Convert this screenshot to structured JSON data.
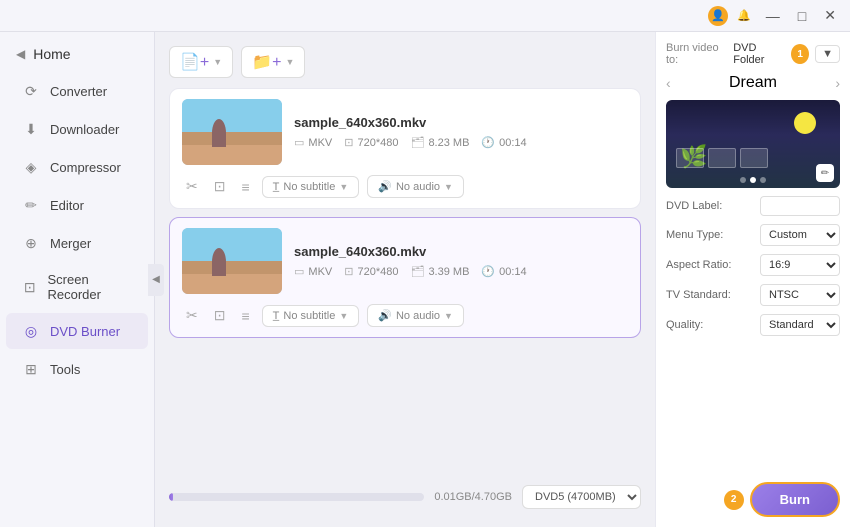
{
  "titlebar": {
    "icon1": "👤",
    "icon2": "🔔",
    "btn_minimize": "—",
    "btn_maximize": "□",
    "btn_close": "✕"
  },
  "sidebar": {
    "home_label": "Home",
    "collapse_icon": "◀",
    "items": [
      {
        "id": "converter",
        "label": "Converter",
        "icon": "⟳"
      },
      {
        "id": "downloader",
        "label": "Downloader",
        "icon": "⬇"
      },
      {
        "id": "compressor",
        "label": "Compressor",
        "icon": "◈"
      },
      {
        "id": "editor",
        "label": "Editor",
        "icon": "✏"
      },
      {
        "id": "merger",
        "label": "Merger",
        "icon": "⊕"
      },
      {
        "id": "screen-recorder",
        "label": "Screen Recorder",
        "icon": "⊡"
      },
      {
        "id": "dvd-burner",
        "label": "DVD Burner",
        "icon": "◎",
        "active": true
      },
      {
        "id": "tools",
        "label": "Tools",
        "icon": "⊞"
      }
    ]
  },
  "toolbar": {
    "add_file_label": "Add File",
    "add_folder_label": "Add Folder",
    "add_file_icon": "📄",
    "add_folder_icon": "📁"
  },
  "files": [
    {
      "name": "sample_640x360.mkv",
      "format": "MKV",
      "resolution": "720*480",
      "size": "8.23 MB",
      "duration": "00:14",
      "subtitle": "No subtitle",
      "audio": "No audio",
      "selected": false
    },
    {
      "name": "sample_640x360.mkv",
      "format": "MKV",
      "resolution": "720*480",
      "size": "3.39 MB",
      "duration": "00:14",
      "subtitle": "No subtitle",
      "audio": "No audio",
      "selected": true
    }
  ],
  "progress": {
    "current": "0.01GB/4.70GB",
    "fill_pct": 1.5,
    "disc_option": "DVD5 (4700MB)"
  },
  "right_panel": {
    "burn_to_label": "Burn video to:",
    "burn_to_value": "DVD Folder",
    "badge1": "1",
    "theme_name": "Dream",
    "theme_prev_icon": "‹",
    "theme_next_icon": "›",
    "dvd_label_label": "DVD Label:",
    "dvd_label_value": "",
    "menu_type_label": "Menu Type:",
    "menu_type_value": "Custom",
    "aspect_ratio_label": "Aspect Ratio:",
    "aspect_ratio_value": "16:9",
    "tv_standard_label": "TV Standard:",
    "tv_standard_value": "NTSC",
    "quality_label": "Quality:",
    "quality_value": "Standard",
    "burn_label": "Burn",
    "badge2": "2"
  }
}
